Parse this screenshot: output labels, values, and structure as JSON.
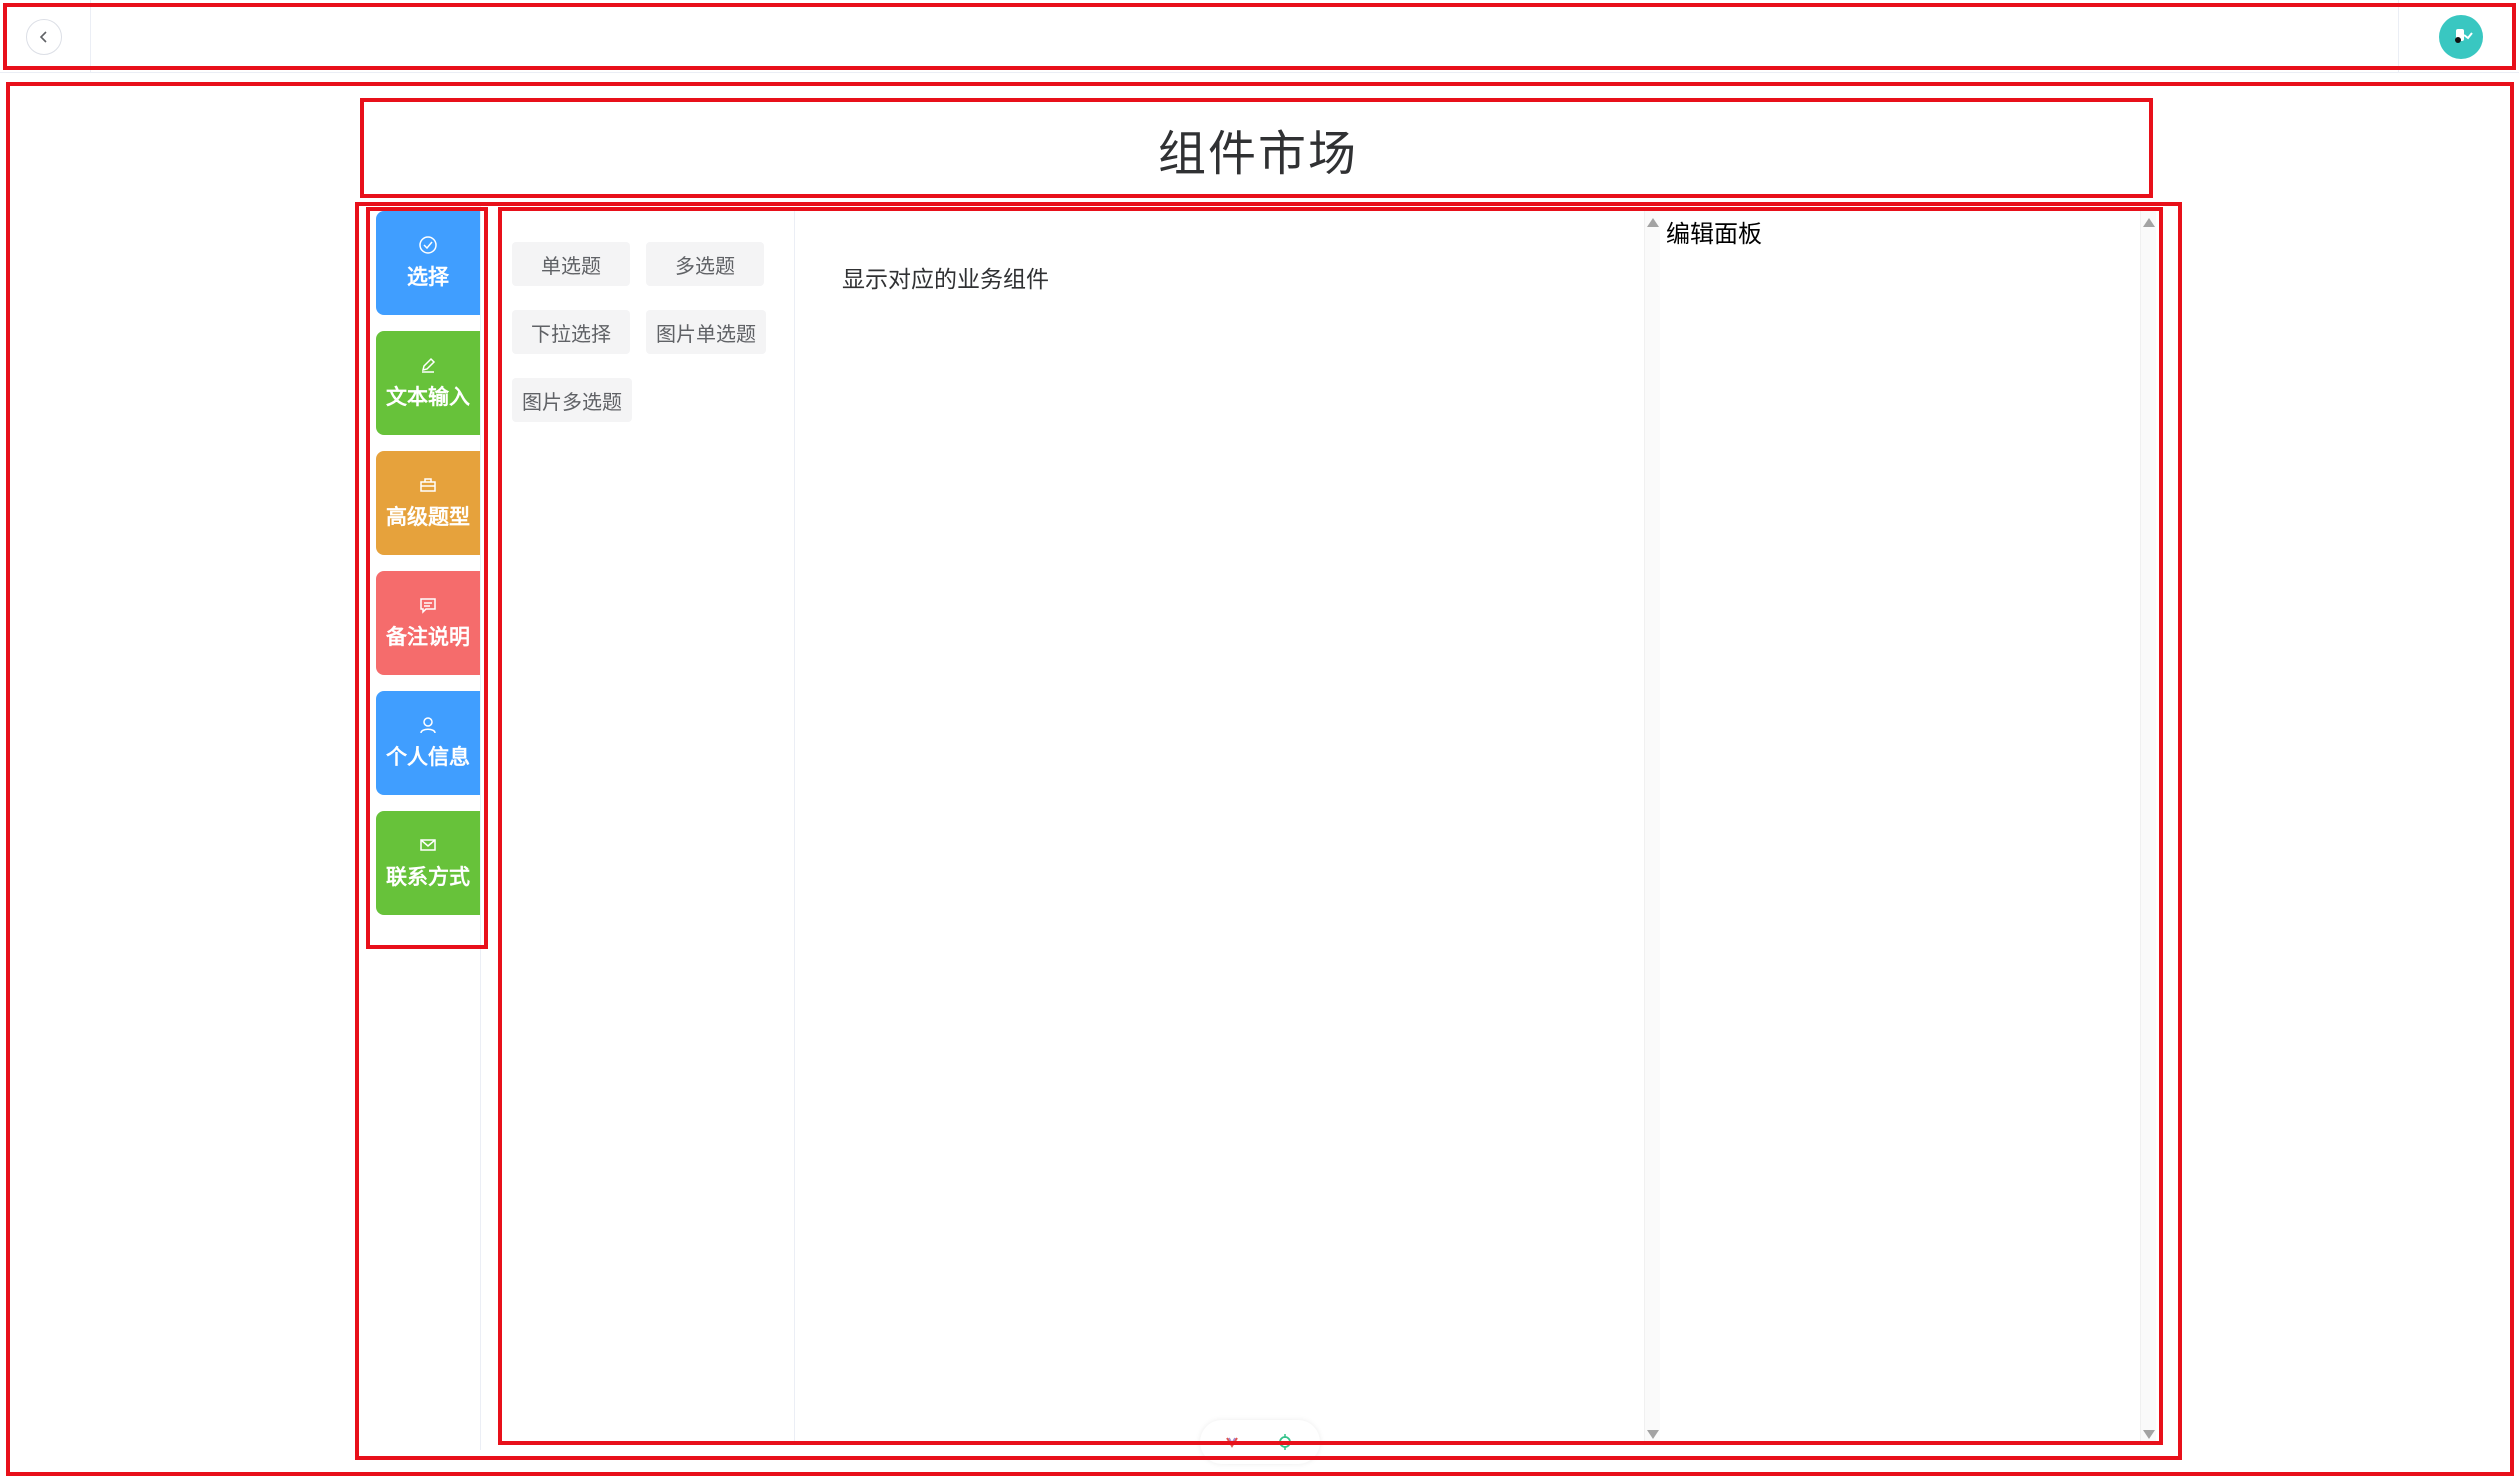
{
  "topbar": {
    "back_icon": "chevron-left-icon",
    "avatar_icon": "avatar-icon",
    "avatar_color": "#39c7c1"
  },
  "page": {
    "title": "组件市场"
  },
  "categories": [
    {
      "label": "选择",
      "icon": "check-circle-icon",
      "color": "#409eff"
    },
    {
      "label": "文本输入",
      "icon": "pen-icon",
      "color": "#67c23a"
    },
    {
      "label": "高级题型",
      "icon": "briefcase-icon",
      "color": "#e6a23c"
    },
    {
      "label": "备注说明",
      "icon": "comment-icon",
      "color": "#f56c6c"
    },
    {
      "label": "个人信息",
      "icon": "user-icon",
      "color": "#409eff"
    },
    {
      "label": "联系方式",
      "icon": "mail-icon",
      "color": "#67c23a"
    }
  ],
  "components": [
    {
      "label": "单选题"
    },
    {
      "label": "多选题"
    },
    {
      "label": "下拉选择"
    },
    {
      "label": "图片单选题"
    },
    {
      "label": "图片多选题"
    }
  ],
  "preview": {
    "text": "显示对应的业务组件"
  },
  "edit_panel": {
    "title": "编辑面板"
  }
}
